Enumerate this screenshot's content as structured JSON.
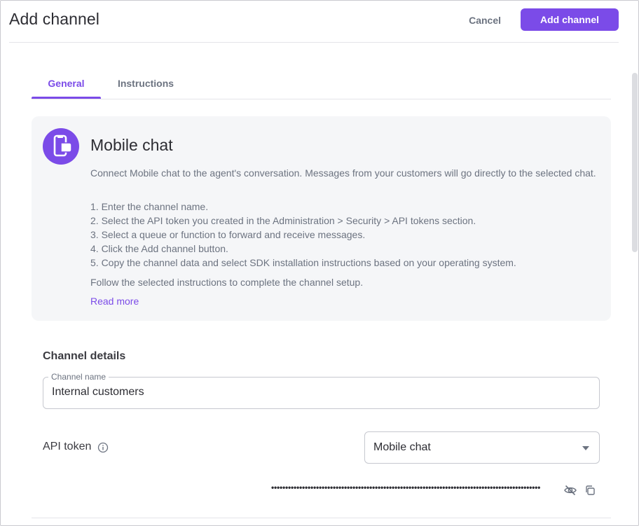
{
  "header": {
    "title": "Add channel",
    "cancel_label": "Cancel",
    "submit_label": "Add channel"
  },
  "tabs": [
    {
      "label": "General",
      "active": true
    },
    {
      "label": "Instructions",
      "active": false
    }
  ],
  "info": {
    "icon": "mobile-chat-icon",
    "title": "Mobile chat",
    "description": "Connect Mobile chat to the agent's conversation. Messages from your customers will go directly to the selected chat.",
    "steps": [
      "1. Enter the channel name.",
      "2. Select the API token you created in the Administration > Security > API tokens section.",
      "3. Select a queue or function to forward and receive messages.",
      "4. Click the Add channel button.",
      "5. Copy the channel data and select SDK installation instructions based on your operating system."
    ],
    "follow_text": "Follow the selected instructions to complete the channel setup.",
    "read_more": "Read more"
  },
  "channel_details": {
    "section_title": "Channel details",
    "name_label": "Channel name",
    "name_value": "Internal customers",
    "api_token_label": "API token",
    "api_token_selected": "Mobile chat",
    "token_masked": "••••••••••••••••••••••••••••••••••••••••••••••••••••••••••••••••••••••••••••••••••••••••••••••••"
  },
  "colors": {
    "accent": "#7b4be8",
    "muted_text": "#6c7380",
    "card_bg": "#f5f6f8"
  }
}
